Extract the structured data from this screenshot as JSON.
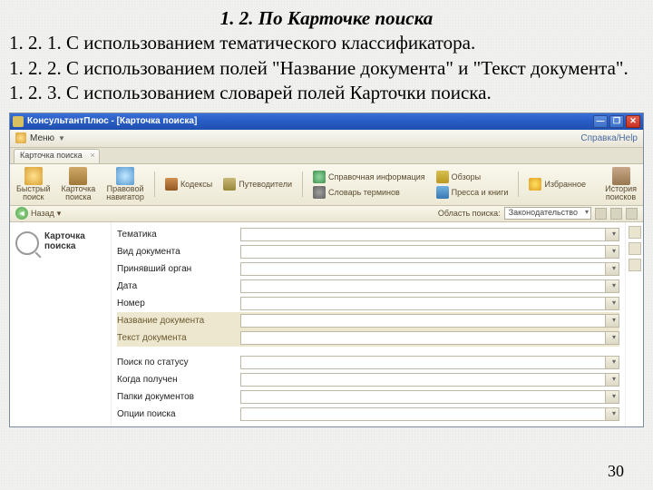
{
  "doc": {
    "heading": "1. 2. По Карточке поиска",
    "p1": "1. 2. 1. С использованием тематического классификатора.",
    "p2": "1. 2. 2. С использованием полей \"Название документа\" и \"Текст документа\".",
    "p3": "1. 2. 3. С использованием словарей полей Карточки поиска.",
    "page_number": "30"
  },
  "app": {
    "titlebar": {
      "title": "КонсультантПлюс - [Карточка поиска]"
    },
    "menu": {
      "label": "Меню",
      "help": "Справка/Help"
    },
    "tab": {
      "label": "Карточка поиска"
    },
    "toolbar": {
      "quick_search_l1": "Быстрый",
      "quick_search_l2": "поиск",
      "card_l1": "Карточка",
      "card_l2": "поиска",
      "nav_l1": "Правовой",
      "nav_l2": "навигатор",
      "codex": "Кодексы",
      "guides": "Путеводители",
      "ref_info": "Справочная информация",
      "terms": "Словарь терминов",
      "reviews": "Обзоры",
      "press": "Пресса и книги",
      "fav": "Избранное",
      "hist_l1": "История",
      "hist_l2": "поисков"
    },
    "nav": {
      "back": "Назад",
      "section_label": "Область поиска:",
      "section_value": "Законодательство"
    },
    "side": {
      "title_l1": "Карточка",
      "title_l2": "поиска"
    },
    "fields": {
      "f0": "Тематика",
      "f1": "Вид документа",
      "f2": "Принявший орган",
      "f3": "Дата",
      "f4": "Номер",
      "f5": "Название документа",
      "f6": "Текст документа",
      "f7": "Поиск по статусу",
      "f8": "Когда получен",
      "f9": "Папки документов",
      "f10": "Опции поиска"
    }
  }
}
